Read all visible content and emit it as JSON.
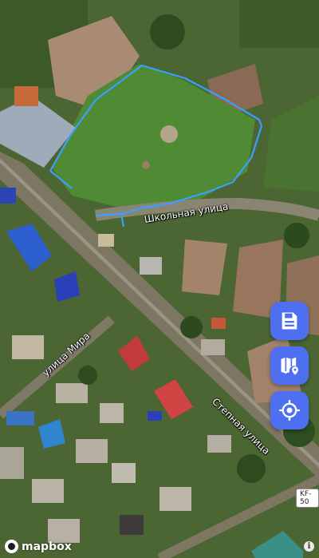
{
  "map": {
    "streets": {
      "shkolnaya": "Школьная улица",
      "mira": "улица Мира",
      "stepnaya": "Степная улица"
    },
    "road_shield": "KF-50",
    "attribution": "mapbox",
    "info_symbol": "i"
  },
  "controls": {
    "save_icon": "floppy-disk-icon",
    "map_pin_icon": "map-location-icon",
    "locate_icon": "crosshair-locate-icon",
    "accent_color": "#4d6ff0"
  },
  "overlay": {
    "polygon_color": "#3aa0ff"
  }
}
